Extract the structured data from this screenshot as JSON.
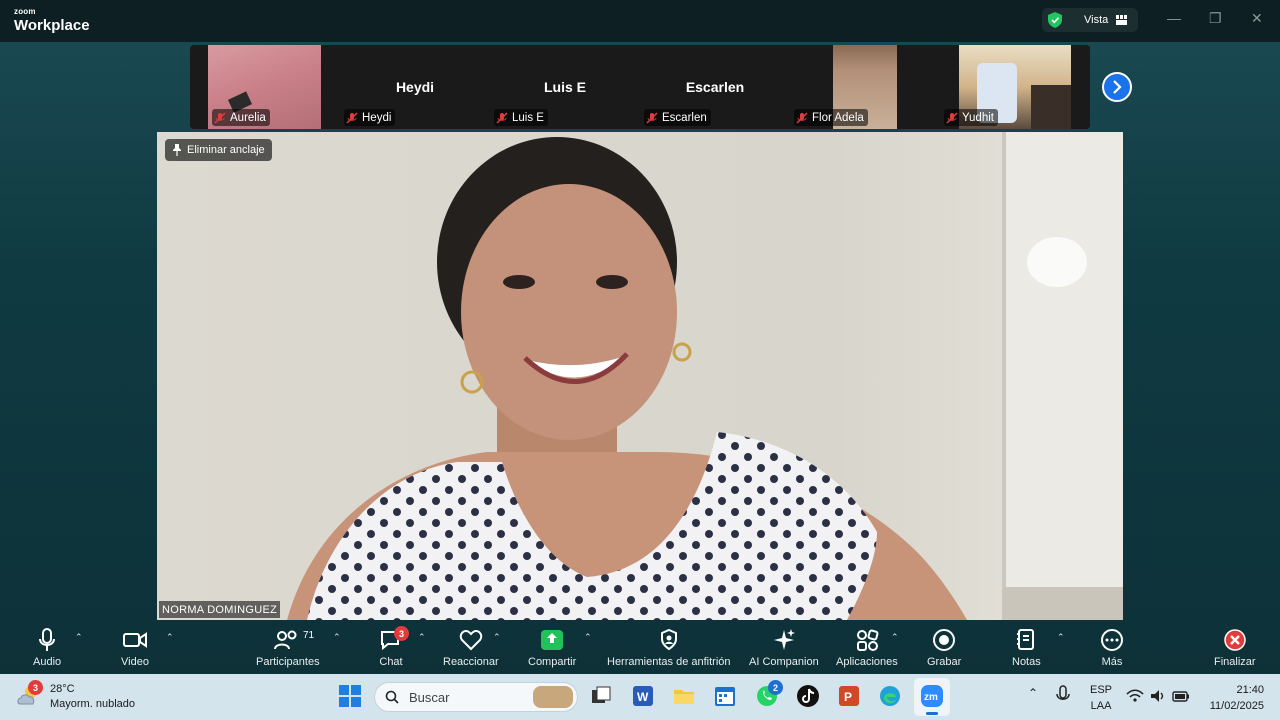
{
  "app": {
    "brand_small": "zoom",
    "brand_big": "Workplace",
    "view_label": "Vista"
  },
  "gallery": {
    "tiles": [
      {
        "name": "Aurelia",
        "center_name": ""
      },
      {
        "name": "Heydi",
        "center_name": "Heydi"
      },
      {
        "name": "Luis E",
        "center_name": "Luis E"
      },
      {
        "name": "Escarlen",
        "center_name": "Escarlen"
      },
      {
        "name": "Flor Adela",
        "center_name": ""
      },
      {
        "name": "Yudhit",
        "center_name": ""
      }
    ]
  },
  "main": {
    "unpin_label": "Eliminar anclaje",
    "speaker_name": "NORMA DOMINGUEZ"
  },
  "toolbar": {
    "audio": "Audio",
    "video": "Video",
    "participants": "Participantes",
    "participants_count": "71",
    "chat": "Chat",
    "chat_badge": "3",
    "react": "Reaccionar",
    "share": "Compartir",
    "host_tools": "Herramientas de anfitrión",
    "ai": "AI Companion",
    "apps": "Aplicaciones",
    "record": "Grabar",
    "notes": "Notas",
    "more": "Más",
    "end": "Finalizar"
  },
  "taskbar": {
    "weather_badge": "3",
    "temperature": "28°C",
    "weather_desc": "Mayorm. nublado",
    "search_placeholder": "Buscar",
    "whatsapp_badge": "2",
    "lang": "ESP",
    "layout": "LAA",
    "time": "21:40",
    "date": "11/02/2025"
  },
  "colors": {
    "accent_blue": "#1a73e8",
    "share_green": "#21c25a",
    "alert_red": "#e23b3b",
    "taskbar_bg": "#d4e4ec"
  }
}
